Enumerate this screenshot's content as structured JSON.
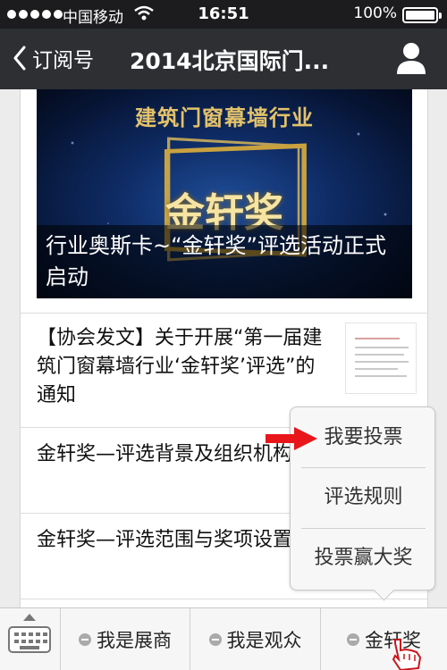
{
  "status_bar": {
    "carrier": "中国移动",
    "time": "16:51",
    "battery": "100%"
  },
  "nav": {
    "back_label": "订阅号",
    "title": "2014北京国际门..."
  },
  "articles": {
    "cover": {
      "logo_text": "建筑门窗幕墙行业",
      "award_text": "金轩奖",
      "caption": "行业奥斯卡~“金轩奖”评选活动正式启动"
    },
    "items": [
      {
        "title": "【协会发文】关于开展“第一届建筑门窗幕墙行业‘金轩奖’评选”的通知"
      },
      {
        "title": "金轩奖—评选背景及组织机构"
      },
      {
        "title": "金轩奖—评选范围与奖项设置"
      }
    ]
  },
  "popup_menu": {
    "items": [
      "我要投票",
      "评选规则",
      "投票赢大奖"
    ]
  },
  "bottom_bar": {
    "tabs": [
      "我是展商",
      "我是观众",
      "金轩奖"
    ]
  },
  "colors": {
    "nav_bg": "#2d2f33",
    "status_bg": "#1c1c1e",
    "arrow": "#e8161b"
  }
}
